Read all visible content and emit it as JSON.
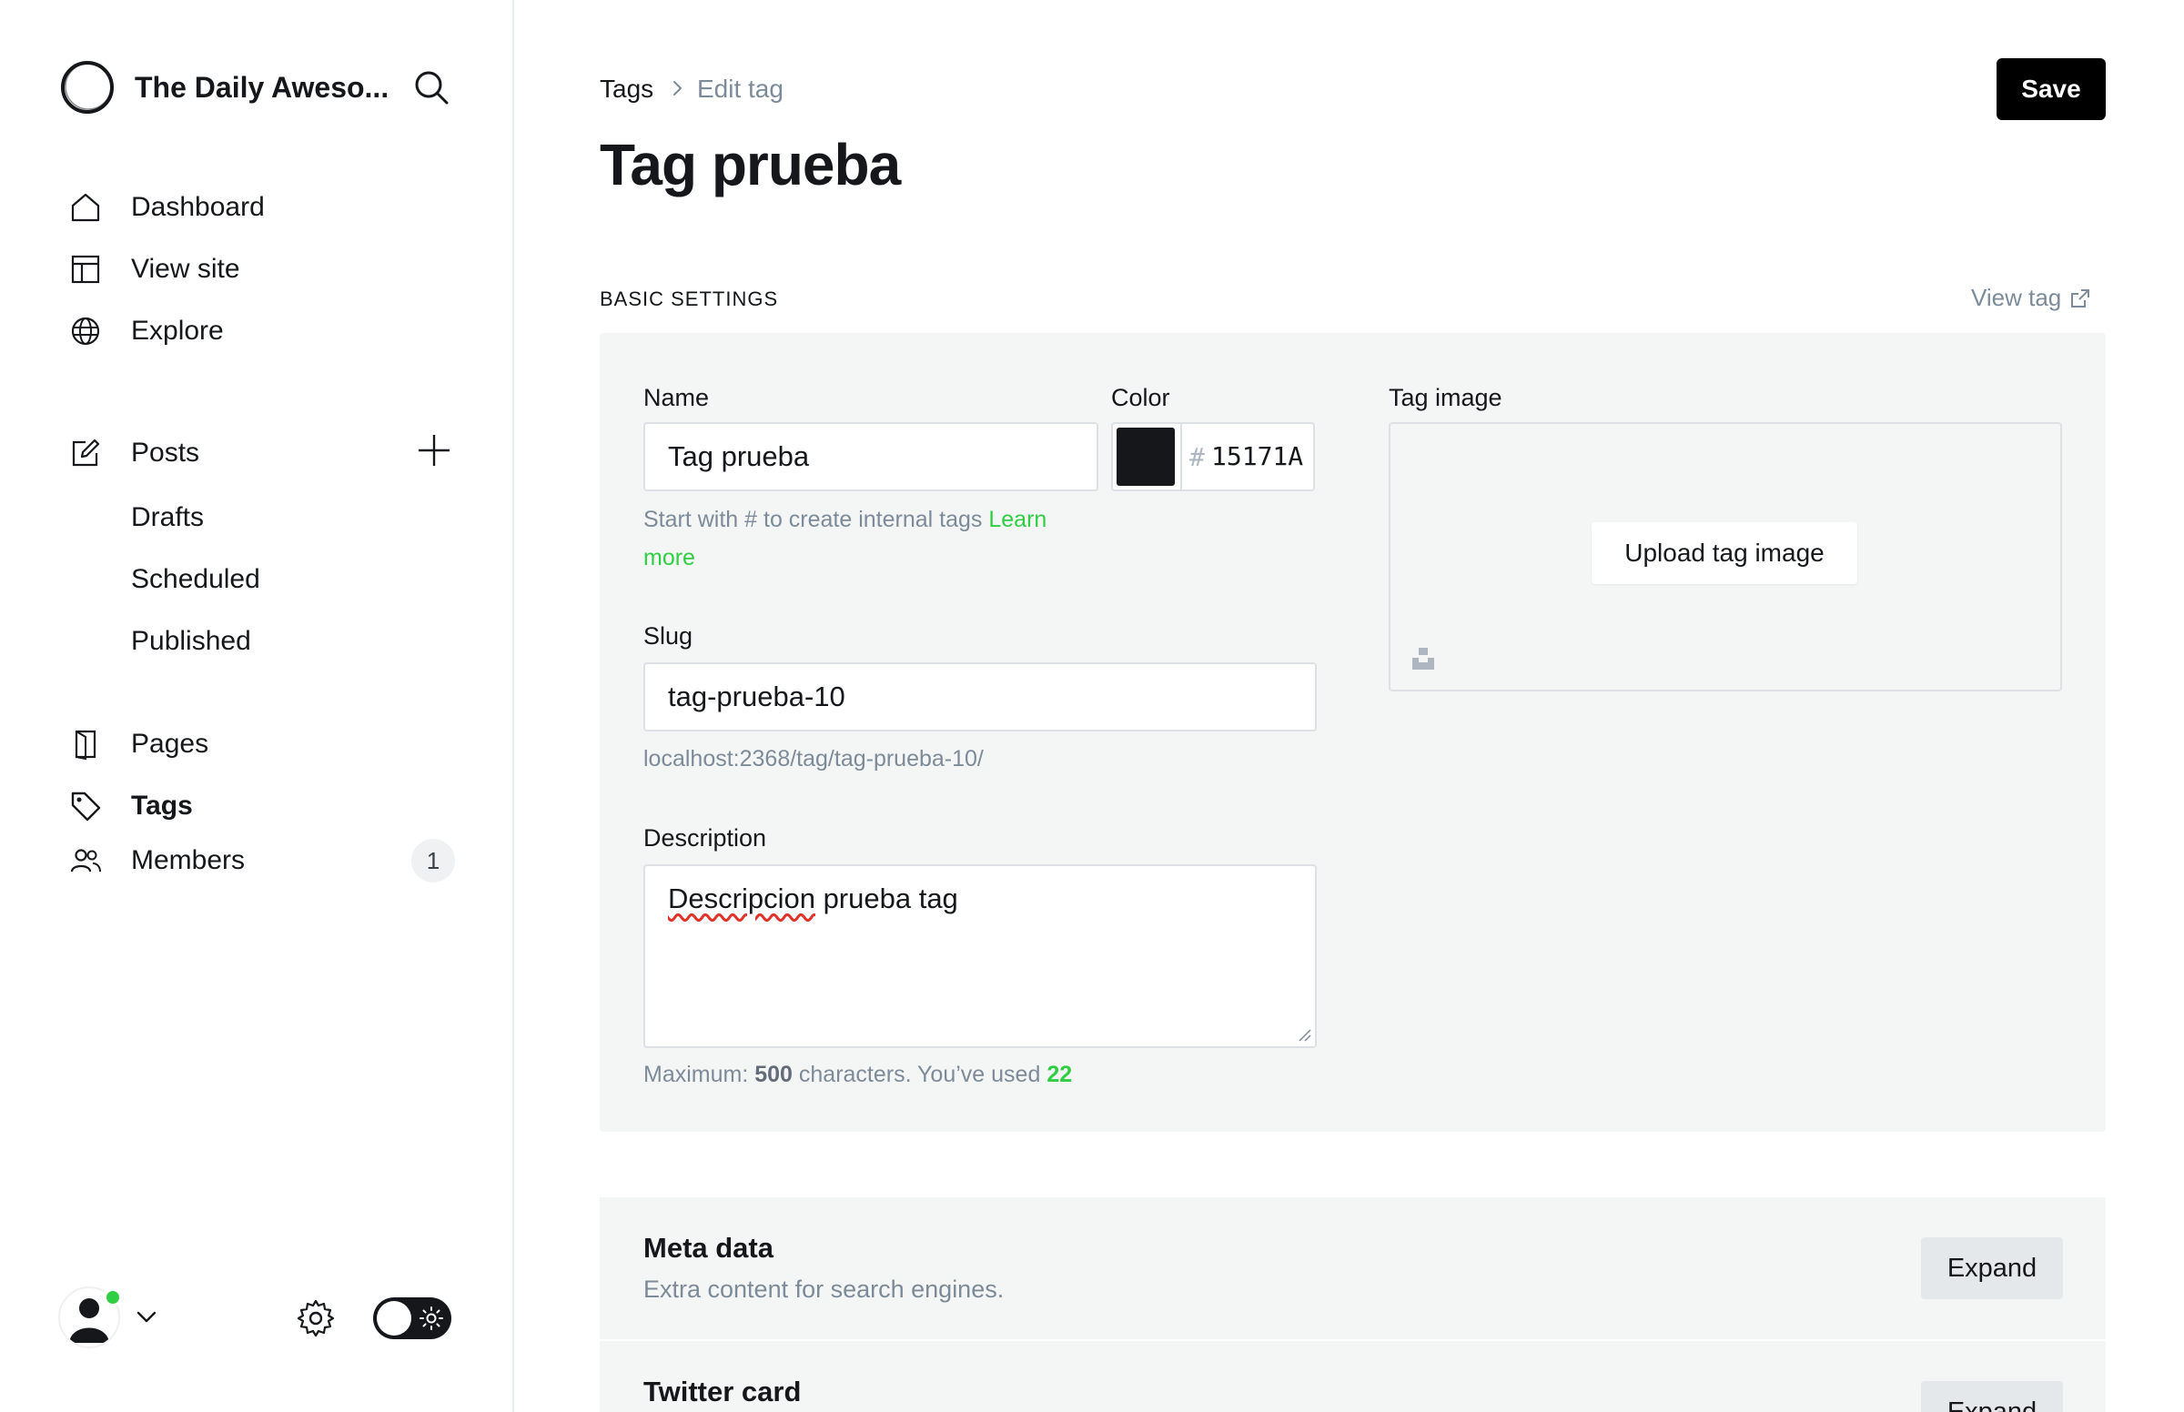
{
  "sidebar": {
    "site_title": "The Daily Aweso...",
    "nav": {
      "dashboard": "Dashboard",
      "view_site": "View site",
      "explore": "Explore",
      "posts": "Posts",
      "drafts": "Drafts",
      "scheduled": "Scheduled",
      "published": "Published",
      "pages": "Pages",
      "tags": "Tags",
      "members": "Members",
      "members_count": "1"
    }
  },
  "header": {
    "breadcrumb_parent": "Tags",
    "breadcrumb_current": "Edit tag",
    "save_label": "Save",
    "title": "Tag prueba"
  },
  "basic_settings": {
    "section_label": "BASIC SETTINGS",
    "view_tag_link": "View tag",
    "name_label": "Name",
    "name_value": "Tag prueba",
    "name_hint": "Start with # to create internal tags",
    "name_hint_link_1": "Learn",
    "name_hint_link_2": "more",
    "color_label": "Color",
    "color_hash": "#",
    "color_value": "15171A",
    "color_swatch": "#15171a",
    "slug_label": "Slug",
    "slug_value": "tag-prueba-10",
    "slug_url": "localhost:2368/tag/tag-prueba-10/",
    "description_label": "Description",
    "description_word_misspelled": "Descripcion",
    "description_rest": " prueba tag",
    "desc_hint_prefix": "Maximum: ",
    "desc_hint_max": "500",
    "desc_hint_middle": " characters. You’ve used ",
    "desc_hint_used": "22",
    "tag_image_label": "Tag image",
    "upload_label": "Upload tag image"
  },
  "cards": {
    "meta_title": "Meta data",
    "meta_desc": "Extra content for search engines.",
    "meta_expand": "Expand",
    "twitter_title": "Twitter card",
    "twitter_expand": "Expand"
  },
  "colors": {
    "accent_green": "#30cf43",
    "text_dark": "#15171a",
    "text_muted": "#7c8b9a"
  },
  "icons": [
    "site-logo-icon",
    "search-icon",
    "home-icon",
    "view-site-icon",
    "globe-icon",
    "edit-icon",
    "plus-icon",
    "pages-icon",
    "tag-icon",
    "members-icon",
    "chevron-right-icon",
    "external-link-icon",
    "unsplash-icon",
    "avatar-icon",
    "chevron-down-icon",
    "gear-icon",
    "sun-icon"
  ]
}
